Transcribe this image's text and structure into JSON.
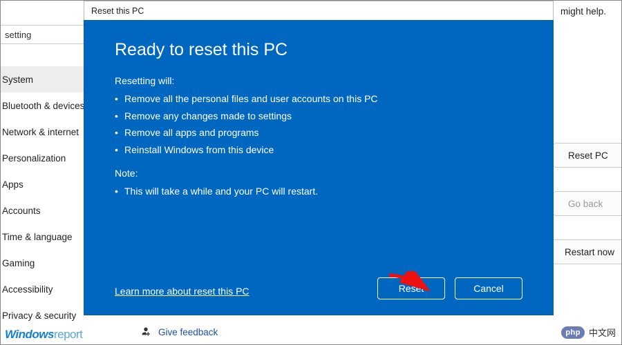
{
  "background": {
    "top_hint_fragment": "might help.",
    "search_value": "setting",
    "sidebar": [
      {
        "label": "System",
        "selected": true
      },
      {
        "label": "Bluetooth & devices",
        "selected": false
      },
      {
        "label": "Network & internet",
        "selected": false
      },
      {
        "label": "Personalization",
        "selected": false
      },
      {
        "label": "Apps",
        "selected": false
      },
      {
        "label": "Accounts",
        "selected": false
      },
      {
        "label": "Time & language",
        "selected": false
      },
      {
        "label": "Gaming",
        "selected": false
      },
      {
        "label": "Accessibility",
        "selected": false
      },
      {
        "label": "Privacy & security",
        "selected": false
      }
    ],
    "right_buttons": {
      "reset_pc": "Reset PC",
      "go_back": "Go back",
      "restart_now": "Restart now"
    },
    "feedback_label": "Give feedback"
  },
  "modal": {
    "titlebar": "Reset this PC",
    "heading": "Ready to reset this PC",
    "resetting_label": "Resetting will:",
    "resetting_bullets": [
      "Remove all the personal files and user accounts on this PC",
      "Remove any changes made to settings",
      "Remove all apps and programs",
      "Reinstall Windows from this device"
    ],
    "note_label": "Note:",
    "note_bullets": [
      "This will take a while and your PC will restart."
    ],
    "learn_more": "Learn more about reset this PC",
    "buttons": {
      "reset": "Reset",
      "cancel": "Cancel"
    }
  },
  "watermarks": {
    "left_a": "Windows",
    "left_b": "report",
    "php": "php",
    "cn": "中文网"
  },
  "colors": {
    "modal_blue": "#0067c0"
  }
}
